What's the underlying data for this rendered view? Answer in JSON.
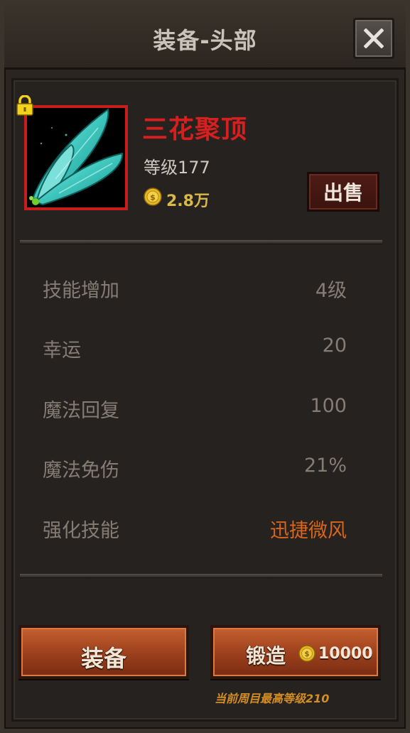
{
  "window": {
    "title": "装备-头部",
    "close_icon": "close-icon"
  },
  "item": {
    "name": "三花聚顶",
    "level": "等级177",
    "price": "2.8万",
    "sell_label": "出售",
    "locked": true,
    "rarity_color": "#d61f1f"
  },
  "stats": [
    {
      "label": "技能增加",
      "value": "4级"
    },
    {
      "label": "幸运",
      "value": "20"
    },
    {
      "label": "魔法回复",
      "value": "100"
    },
    {
      "label": "魔法免伤",
      "value": "21%"
    },
    {
      "label": "强化技能",
      "value": "迅捷微风",
      "highlight": true
    }
  ],
  "actions": {
    "equip_label": "装备",
    "forge_label": "锻造",
    "forge_cost": "10000"
  },
  "note": "当前周目最高等级210",
  "colors": {
    "accent_orange": "#d9661a",
    "gold": "#d8b84a",
    "button": "#9a3f1c"
  }
}
